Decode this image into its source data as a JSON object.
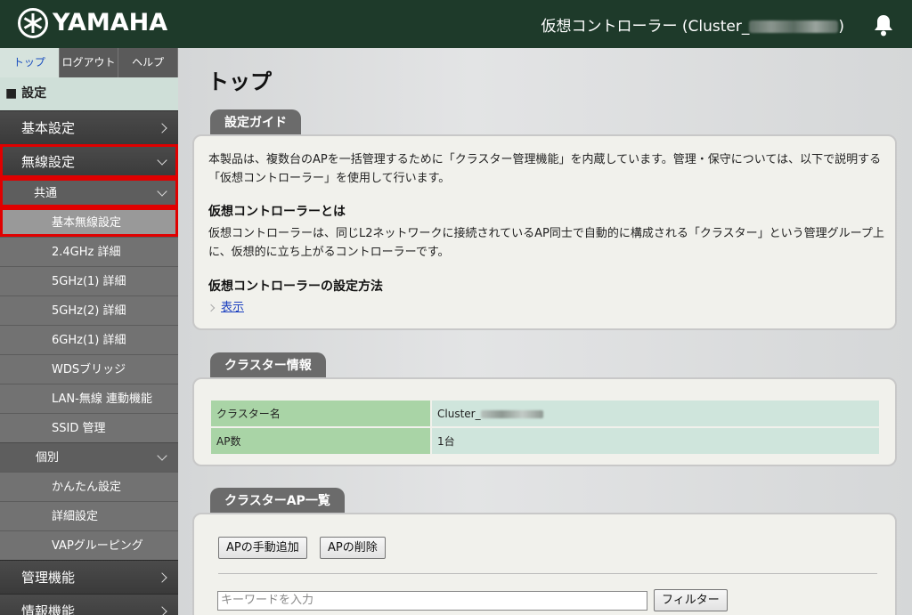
{
  "header": {
    "logo_text": "YAMAHA",
    "title": "仮想コントローラー (Cluster_",
    "title_suffix": ")"
  },
  "sidebar": {
    "tabs": [
      "トップ",
      "ログアウト",
      "ヘルプ"
    ],
    "section": "■ 設定",
    "items": {
      "basic": "基本設定",
      "wireless": "無線設定",
      "common": "共通",
      "basic_wireless": "基本無線設定",
      "ghz24": "2.4GHz 詳細",
      "ghz5_1": "5GHz(1) 詳細",
      "ghz5_2": "5GHz(2) 詳細",
      "ghz6_1": "6GHz(1) 詳細",
      "wds": "WDSブリッジ",
      "lan_link": "LAN-無線 連動機能",
      "ssid": "SSID 管理",
      "individual": "個別",
      "easy": "かんたん設定",
      "detail": "詳細設定",
      "vap": "VAPグルーピング",
      "mgmt": "管理機能",
      "next": "情報機能"
    }
  },
  "main": {
    "page_title": "トップ",
    "guide": {
      "tab": "設定ガイド",
      "intro": "本製品は、複数台のAPを一括管理するために「クラスター管理機能」を内蔵しています。管理・保守については、以下で説明する「仮想コントローラー」を使用して行います。",
      "h1": "仮想コントローラーとは",
      "p1": "仮想コントローラーは、同じL2ネットワークに接続されているAP同士で自動的に構成される「クラスター」という管理グループ上に、仮想的に立ち上がるコントローラーです。",
      "h2": "仮想コントローラーの設定方法",
      "show_link": "表示"
    },
    "cluster_info": {
      "tab": "クラスター情報",
      "rows": [
        {
          "key": "クラスター名",
          "value": "Cluster_"
        },
        {
          "key": "AP数",
          "value": "1台"
        }
      ]
    },
    "ap_list": {
      "tab": "クラスターAP一覧",
      "add_button": "APの手動追加",
      "delete_button": "APの削除",
      "keyword_placeholder": "キーワードを入力",
      "filter_button": "フィルター"
    }
  },
  "colors": {
    "header_bg": "#1e3a2a",
    "highlight": "#e00000",
    "table_key": "#a9d4a6",
    "table_value": "#cfe5dc"
  }
}
